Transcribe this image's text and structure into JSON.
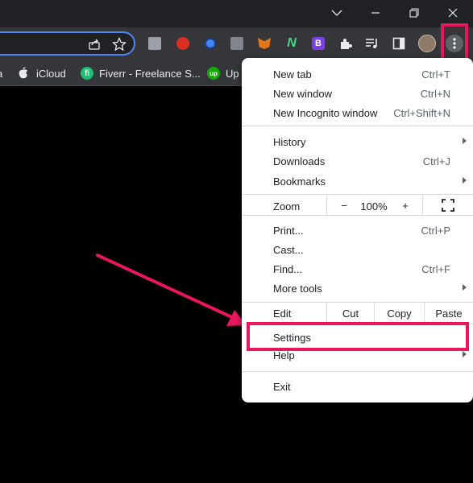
{
  "bookmarks": [
    {
      "label": "iCloud",
      "icon": "apple-icon"
    },
    {
      "label": "Fiverr - Freelance S...",
      "icon": "fiverr-icon",
      "badge": "fi",
      "color": "#1dbf73"
    },
    {
      "label": "Up",
      "icon": "upwork-icon",
      "badge": "up",
      "color": "#14a800"
    }
  ],
  "menu": {
    "new_tab": {
      "label": "New tab",
      "shortcut": "Ctrl+T"
    },
    "new_window": {
      "label": "New window",
      "shortcut": "Ctrl+N"
    },
    "incognito": {
      "label": "New Incognito window",
      "shortcut": "Ctrl+Shift+N"
    },
    "history": {
      "label": "History"
    },
    "downloads": {
      "label": "Downloads",
      "shortcut": "Ctrl+J"
    },
    "bookmarks": {
      "label": "Bookmarks"
    },
    "zoom": {
      "label": "Zoom",
      "minus": "−",
      "value": "100%",
      "plus": "+"
    },
    "print": {
      "label": "Print...",
      "shortcut": "Ctrl+P"
    },
    "cast": {
      "label": "Cast..."
    },
    "find": {
      "label": "Find...",
      "shortcut": "Ctrl+F"
    },
    "more_tools": {
      "label": "More tools"
    },
    "edit": {
      "label": "Edit",
      "cut": "Cut",
      "copy": "Copy",
      "paste": "Paste"
    },
    "settings": {
      "label": "Settings"
    },
    "help": {
      "label": "Help"
    },
    "exit": {
      "label": "Exit"
    }
  },
  "colors": {
    "highlight": "#e8175d",
    "omnibox_border": "#4f86ec"
  }
}
